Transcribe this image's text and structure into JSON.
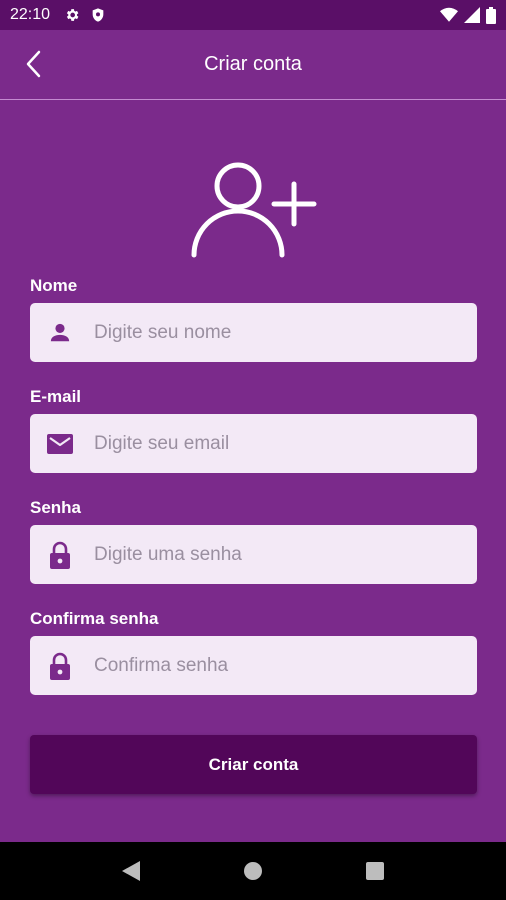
{
  "status_bar": {
    "time": "22:10",
    "icons": [
      "gear-icon",
      "shield-icon",
      "wifi-icon",
      "signal-icon",
      "battery-icon"
    ]
  },
  "app_bar": {
    "title": "Criar conta",
    "back_icon": "chevron-left-icon"
  },
  "header_icon": "add-user-icon",
  "form": {
    "name": {
      "label": "Nome",
      "placeholder": "Digite seu nome",
      "value": "",
      "icon": "person-icon"
    },
    "email": {
      "label": "E-mail",
      "placeholder": "Digite seu email",
      "value": "",
      "icon": "mail-icon"
    },
    "password": {
      "label": "Senha",
      "placeholder": "Digite uma senha",
      "value": "",
      "icon": "lock-icon"
    },
    "confirm_password": {
      "label": "Confirma senha",
      "placeholder": "Confirma senha",
      "value": "",
      "icon": "lock-icon"
    },
    "submit_label": "Criar conta"
  },
  "nav_bar": {
    "buttons": [
      "back-triangle-icon",
      "home-circle-icon",
      "recents-square-icon"
    ]
  },
  "colors": {
    "background": "#7b2a8b",
    "status_bar": "#5a0f67",
    "input_background": "#f3e9f6",
    "icon_accent": "#7b2a8b",
    "button": "#520659",
    "divider": "#c48ad0"
  }
}
